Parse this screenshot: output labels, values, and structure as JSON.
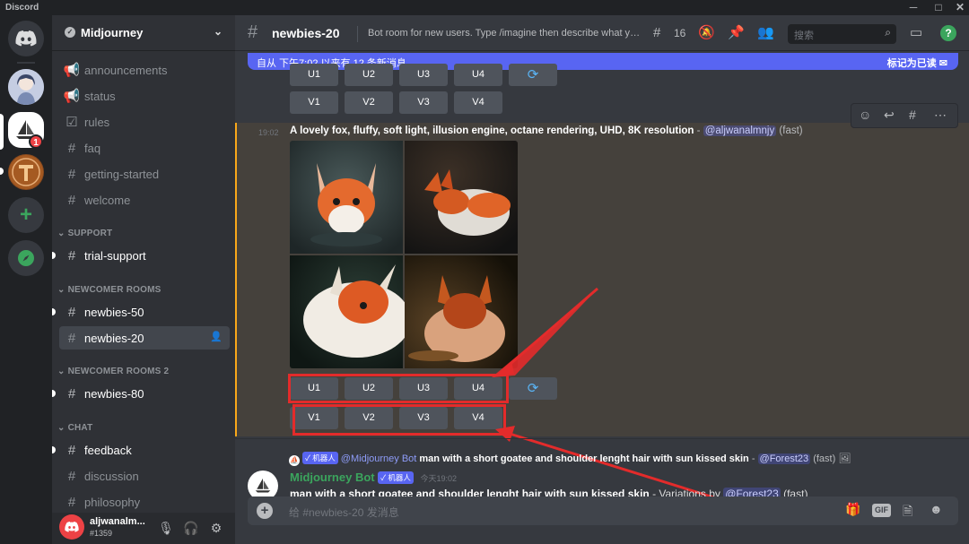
{
  "window": {
    "app_name": "Discord",
    "minimize": "─",
    "maximize": "□",
    "close": "✕"
  },
  "servers": {
    "home_icon": "discord-logo-icon",
    "badge_count": "1",
    "add_icon": "+",
    "explore_icon": "compass-icon"
  },
  "guild": {
    "name": "Midjourney",
    "chevron": "⌄"
  },
  "channels": [
    {
      "label": "announcements",
      "icon": "megaphone-icon"
    },
    {
      "label": "status",
      "icon": "megaphone-icon"
    },
    {
      "label": "rules",
      "icon": "checkbox-icon"
    },
    {
      "label": "faq",
      "icon": "hash-icon"
    },
    {
      "label": "getting-started",
      "icon": "hash-icon"
    },
    {
      "label": "welcome",
      "icon": "hash-icon"
    }
  ],
  "categories": {
    "support": "SUPPORT",
    "newcomer": "NEWCOMER ROOMS",
    "newcomer2": "NEWCOMER ROOMS 2",
    "chat": "CHAT"
  },
  "support_channels": [
    {
      "label": "trial-support"
    }
  ],
  "newcomer_channels": [
    {
      "label": "newbies-50"
    },
    {
      "label": "newbies-20"
    }
  ],
  "newcomer2_channels": [
    {
      "label": "newbies-80"
    }
  ],
  "chat_channels": [
    {
      "label": "feedback"
    },
    {
      "label": "discussion"
    },
    {
      "label": "philosophy"
    }
  ],
  "user": {
    "name": "aljwanalm...",
    "tag": "#1359"
  },
  "header": {
    "channel": "newbies-20",
    "topic": "Bot room for new users. Type /imagine then describe what you want to draw...",
    "threads_count": "16",
    "search_placeholder": "搜索",
    "help": "?"
  },
  "new_messages_bar": {
    "left": "自从 下午7:02 以来有 12 条新消息",
    "right": "标记为已读"
  },
  "top_buttons": {
    "u": [
      "U1",
      "U2",
      "U3",
      "U4"
    ],
    "v": [
      "V1",
      "V2",
      "V3",
      "V4"
    ]
  },
  "message": {
    "time": "19:02",
    "prompt": "A lovely fox, fluffy, soft light, illusion engine, octane rendering, UHD, 8K resolution",
    "dash": " - ",
    "mention": "@aljwanalmnjy",
    "speed": " (fast)",
    "buttons_u": [
      "U1",
      "U2",
      "U3",
      "U4"
    ],
    "buttons_v": [
      "V1",
      "V2",
      "V3",
      "V4"
    ]
  },
  "reply": {
    "badge": "✓ 机器人",
    "author": "@Midjourney Bot",
    "text": "man with a short goatee and shoulder lenght hair with sun kissed skin",
    "mention": "@Forest23",
    "speed": " (fast)"
  },
  "bot": {
    "name": "Midjourney Bot",
    "badge": "✓ 机器人",
    "when": "今天19:02",
    "line_text": "man with a short goatee and shoulder lenght hair with sun kissed skin",
    "line_rest": " - Variations by ",
    "line_mention": "@Forest23",
    "line_speed": " (fast)"
  },
  "composer": {
    "placeholder": "给 #newbies-20 发消息",
    "gif": "GIF"
  },
  "colors": {
    "accent": "#5865f2",
    "highlight": "#faa81a",
    "annotation_red": "#e32b2b",
    "bot_green": "#3ba55d"
  }
}
